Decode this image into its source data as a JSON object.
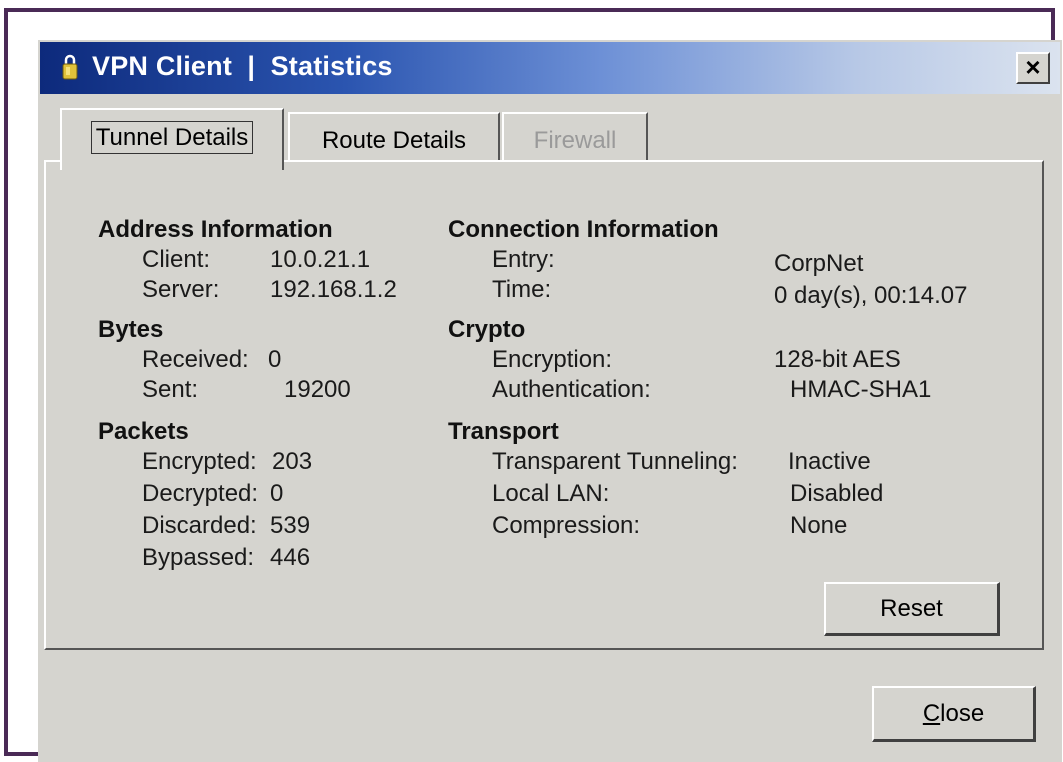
{
  "window": {
    "title": "VPN Client  |  Statistics",
    "close_glyph": "×",
    "icon": "lock-icon"
  },
  "tabs": [
    {
      "label": "Tunnel Details",
      "state": "active"
    },
    {
      "label": "Route Details",
      "state": "normal"
    },
    {
      "label": "Firewall",
      "state": "disabled"
    }
  ],
  "address": {
    "header": "Address Information",
    "client_label": "Client:",
    "client_value": "10.0.21.1",
    "server_label": "Server:",
    "server_value": "192.168.1.2"
  },
  "bytes": {
    "header": "Bytes",
    "received_label": "Received:",
    "received_value": "0",
    "sent_label": "Sent:",
    "sent_value": "19200"
  },
  "packets": {
    "header": "Packets",
    "encrypted_label": "Encrypted:",
    "encrypted_value": "203",
    "decrypted_label": "Decrypted:",
    "decrypted_value": "0",
    "discarded_label": "Discarded:",
    "discarded_value": "539",
    "bypassed_label": "Bypassed:",
    "bypassed_value": "446"
  },
  "connection": {
    "header": "Connection Information",
    "entry_label": "Entry:",
    "entry_value": "CorpNet",
    "time_label": "Time:",
    "time_value": "0 day(s), 00:14.07"
  },
  "crypto": {
    "header": "Crypto",
    "encryption_label": "Encryption:",
    "encryption_value": "128-bit AES",
    "authentication_label": "Authentication:",
    "authentication_value": "HMAC-SHA1"
  },
  "transport": {
    "header": "Transport",
    "transparent_label": "Transparent Tunneling:",
    "transparent_value": "Inactive",
    "local_lan_label": "Local LAN:",
    "local_lan_value": "Disabled",
    "compression_label": "Compression:",
    "compression_value": "None"
  },
  "buttons": {
    "reset": "Reset",
    "close_mnemonic": "C",
    "close_rest": "lose"
  }
}
